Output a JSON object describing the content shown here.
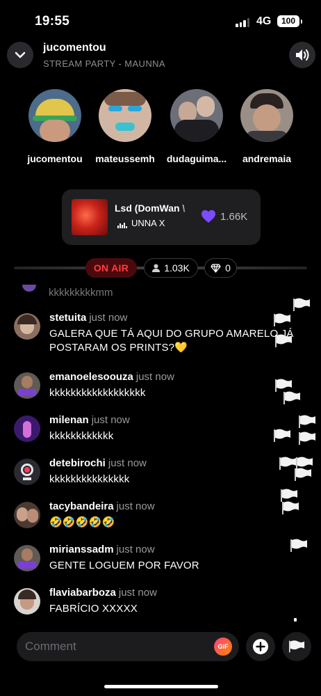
{
  "status_bar": {
    "time": "19:55",
    "network": "4G",
    "battery": "100"
  },
  "header": {
    "title": "jucomentou",
    "subtitle": "STREAM PARTY - MAUNNA"
  },
  "participants": [
    {
      "name": "jucomentou"
    },
    {
      "name": "mateussemh"
    },
    {
      "name": "dudaguima..."
    },
    {
      "name": "andremaia"
    }
  ],
  "now_playing": {
    "title": "Lsd (DomWan \\",
    "artist": "UNNA X",
    "likes": "1.66K"
  },
  "live": {
    "status": "ON AIR",
    "viewers": "1.03K",
    "gems": "0"
  },
  "chat": {
    "partial_message": "kkkkkkkkkmm",
    "messages": [
      {
        "user": "stetuita",
        "time": "just now",
        "text": "GALERA QUE TÁ AQUI DO GRUPO AMARELO JÁ POSTARAM OS PRINTS?💛"
      },
      {
        "user": "emanoelesoouza",
        "time": "just now",
        "text": "kkkkkkkkkkkkkkkkkk"
      },
      {
        "user": "milenan",
        "time": "just now",
        "text": "kkkkkkkkkkkk"
      },
      {
        "user": "detebirochi",
        "time": "just now",
        "text": "kkkkkkkkkkkkkkk"
      },
      {
        "user": "tacybandeira",
        "time": "just now",
        "text": "🤣🤣🤣🤣🤣"
      },
      {
        "user": "mirianssadm",
        "time": "just now",
        "text": "GENTE LOGUEM POR FAVOR"
      },
      {
        "user": "flaviabarboza",
        "time": "just now",
        "text": "FABRÍCIO XXXXX"
      }
    ]
  },
  "composer": {
    "placeholder": "Comment",
    "gif_label": "GIF"
  },
  "colors": {
    "accent_purple": "#7b4dff",
    "on_air_red": "#ff3b3b",
    "gif_gradient": "#ff3d7f"
  }
}
